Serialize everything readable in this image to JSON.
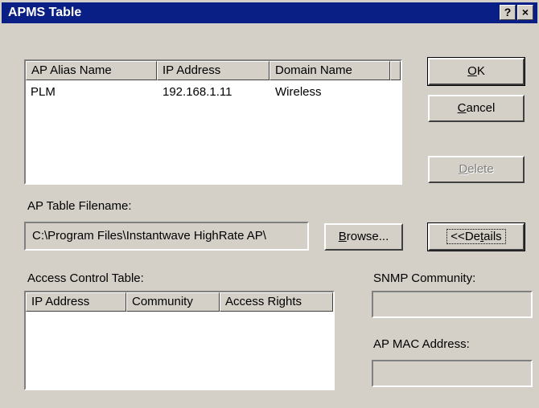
{
  "window": {
    "title": "APMS Table",
    "help_label": "?",
    "close_label": "×"
  },
  "ap_table": {
    "columns": [
      "AP Alias Name",
      "IP Address",
      "Domain Name"
    ],
    "rows": [
      [
        "PLM",
        "192.168.1.11",
        "Wireless"
      ]
    ]
  },
  "buttons": {
    "ok": {
      "prefix": "",
      "mnemonic": "O",
      "rest": "K"
    },
    "cancel": {
      "prefix": "",
      "mnemonic": "C",
      "rest": "ancel"
    },
    "delete": {
      "prefix": "",
      "mnemonic": "D",
      "rest": "elete"
    },
    "browse": {
      "prefix": "",
      "mnemonic": "B",
      "rest": "rowse..."
    },
    "details": {
      "prefix": "<<De",
      "mnemonic": "t",
      "rest": "ails"
    }
  },
  "filename": {
    "label": "AP Table Filename:",
    "value": "C:\\Program Files\\Instantwave HighRate AP\\"
  },
  "access_control": {
    "label": "Access Control Table:",
    "columns": [
      "IP Address",
      "Community",
      "Access Rights"
    ]
  },
  "snmp": {
    "label": "SNMP Community:",
    "value": ""
  },
  "mac": {
    "label": "AP MAC Address:",
    "value": ""
  }
}
